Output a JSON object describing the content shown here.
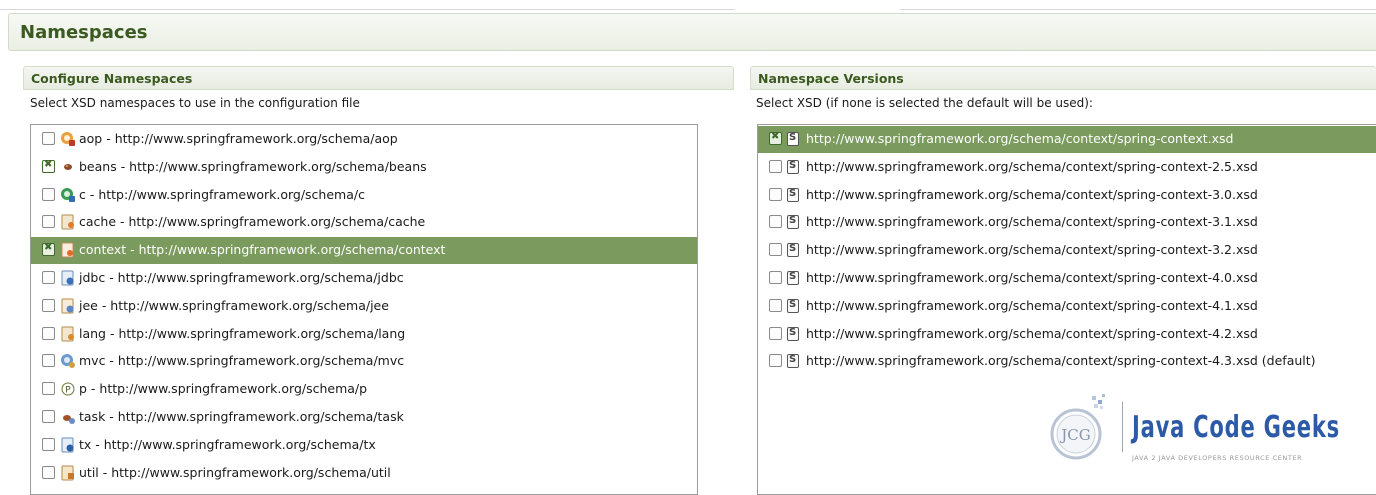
{
  "page": {
    "title": "Namespaces"
  },
  "configure": {
    "title": "Configure Namespaces",
    "description": "Select XSD namespaces to use in the configuration file",
    "items": [
      {
        "label": "aop - http://www.springframework.org/schema/aop",
        "checked": false,
        "selected": false,
        "icon": "aop-icon"
      },
      {
        "label": "beans - http://www.springframework.org/schema/beans",
        "checked": true,
        "selected": false,
        "icon": "beans-icon"
      },
      {
        "label": "c - http://www.springframework.org/schema/c",
        "checked": false,
        "selected": false,
        "icon": "c-icon"
      },
      {
        "label": "cache - http://www.springframework.org/schema/cache",
        "checked": false,
        "selected": false,
        "icon": "cache-icon"
      },
      {
        "label": "context - http://www.springframework.org/schema/context",
        "checked": true,
        "selected": true,
        "icon": "context-icon"
      },
      {
        "label": "jdbc - http://www.springframework.org/schema/jdbc",
        "checked": false,
        "selected": false,
        "icon": "jdbc-icon"
      },
      {
        "label": "jee - http://www.springframework.org/schema/jee",
        "checked": false,
        "selected": false,
        "icon": "jee-icon"
      },
      {
        "label": "lang - http://www.springframework.org/schema/lang",
        "checked": false,
        "selected": false,
        "icon": "lang-icon"
      },
      {
        "label": "mvc - http://www.springframework.org/schema/mvc",
        "checked": false,
        "selected": false,
        "icon": "mvc-icon"
      },
      {
        "label": "p - http://www.springframework.org/schema/p",
        "checked": false,
        "selected": false,
        "icon": "p-icon"
      },
      {
        "label": "task - http://www.springframework.org/schema/task",
        "checked": false,
        "selected": false,
        "icon": "task-icon"
      },
      {
        "label": "tx - http://www.springframework.org/schema/tx",
        "checked": false,
        "selected": false,
        "icon": "tx-icon"
      },
      {
        "label": "util - http://www.springframework.org/schema/util",
        "checked": false,
        "selected": false,
        "icon": "util-icon"
      }
    ]
  },
  "versions": {
    "title": "Namespace Versions",
    "description": "Select XSD (if none is selected the default will be used):",
    "schema_glyph": "S",
    "items": [
      {
        "label": "http://www.springframework.org/schema/context/spring-context.xsd",
        "checked": true,
        "selected": true
      },
      {
        "label": "http://www.springframework.org/schema/context/spring-context-2.5.xsd",
        "checked": false,
        "selected": false
      },
      {
        "label": "http://www.springframework.org/schema/context/spring-context-3.0.xsd",
        "checked": false,
        "selected": false
      },
      {
        "label": "http://www.springframework.org/schema/context/spring-context-3.1.xsd",
        "checked": false,
        "selected": false
      },
      {
        "label": "http://www.springframework.org/schema/context/spring-context-3.2.xsd",
        "checked": false,
        "selected": false
      },
      {
        "label": "http://www.springframework.org/schema/context/spring-context-4.0.xsd",
        "checked": false,
        "selected": false
      },
      {
        "label": "http://www.springframework.org/schema/context/spring-context-4.1.xsd",
        "checked": false,
        "selected": false
      },
      {
        "label": "http://www.springframework.org/schema/context/spring-context-4.2.xsd",
        "checked": false,
        "selected": false
      },
      {
        "label": "http://www.springframework.org/schema/context/spring-context-4.3.xsd (default)",
        "checked": false,
        "selected": false
      }
    ]
  },
  "watermark": {
    "name": "Java Code Geeks",
    "tagline": "JAVA 2 JAVA DEVELOPERS RESOURCE CENTER",
    "badge": "JCG"
  },
  "colors": {
    "selection": "#7a9a5e",
    "heading": "#3b5a1f",
    "logo": "#2c5aa6"
  }
}
